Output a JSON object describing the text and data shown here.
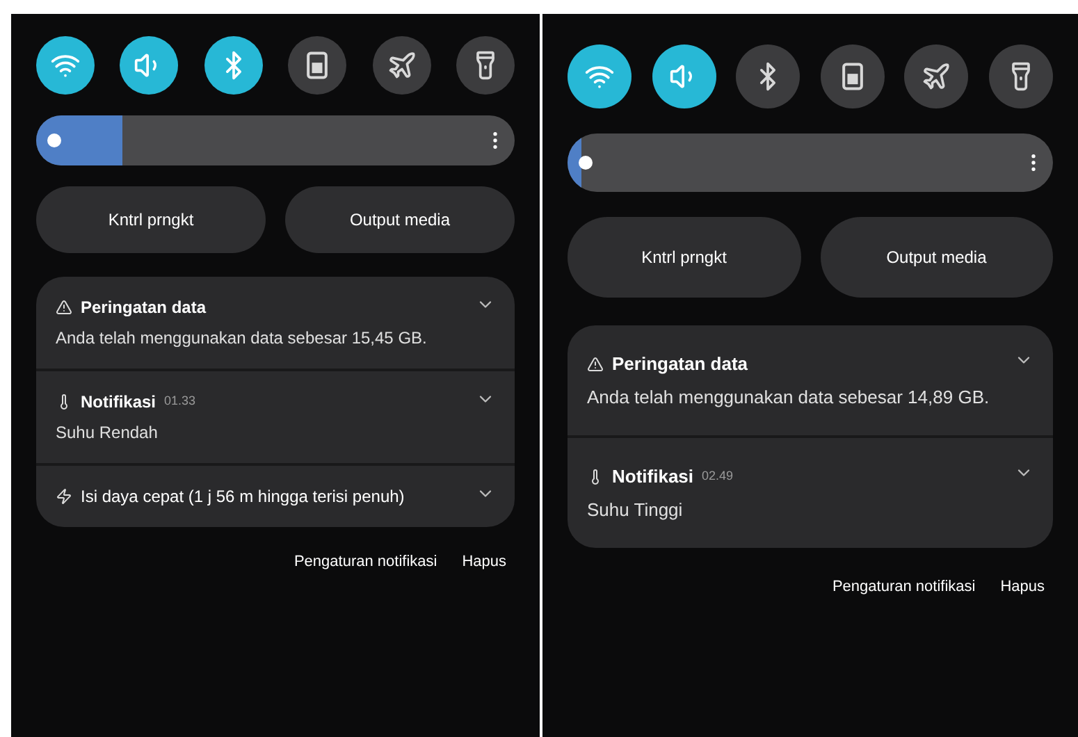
{
  "panels": [
    {
      "toggles": [
        {
          "kind": "wifi",
          "on": true
        },
        {
          "kind": "sound",
          "on": true
        },
        {
          "kind": "bluetooth",
          "on": true
        },
        {
          "kind": "sim",
          "on": false
        },
        {
          "kind": "airplane",
          "on": false
        },
        {
          "kind": "flashlight",
          "on": false
        }
      ],
      "brightness": {
        "level": 0.18
      },
      "buttons": [
        "Kntrl prngkt",
        "Output media"
      ],
      "notifications": [
        {
          "kind": "warning",
          "title": "Peringatan data",
          "text": "Anda telah menggunakan data sebesar 15,45 GB."
        },
        {
          "kind": "temperature",
          "title": "Notifikasi",
          "time": "01.33",
          "text": "Suhu Rendah"
        },
        {
          "kind": "charging",
          "title": "Isi daya cepat (1 j 56 m hingga terisi penuh)"
        }
      ],
      "footer": [
        "Pengaturan notifikasi",
        "Hapus"
      ]
    },
    {
      "toggles": [
        {
          "kind": "wifi",
          "on": true
        },
        {
          "kind": "sound",
          "on": true
        },
        {
          "kind": "bluetooth",
          "on": false
        },
        {
          "kind": "sim",
          "on": false
        },
        {
          "kind": "airplane",
          "on": false
        },
        {
          "kind": "flashlight",
          "on": false
        }
      ],
      "brightness": {
        "level": 0.03
      },
      "buttons": [
        "Kntrl prngkt",
        "Output media"
      ],
      "notifications": [
        {
          "kind": "warning",
          "title": "Peringatan data",
          "text": "Anda telah menggunakan data sebesar 14,89 GB."
        },
        {
          "kind": "temperature",
          "title": "Notifikasi",
          "time": "02.49",
          "text": "Suhu Tinggi"
        }
      ],
      "footer": [
        "Pengaturan notifikasi",
        "Hapus"
      ]
    }
  ]
}
